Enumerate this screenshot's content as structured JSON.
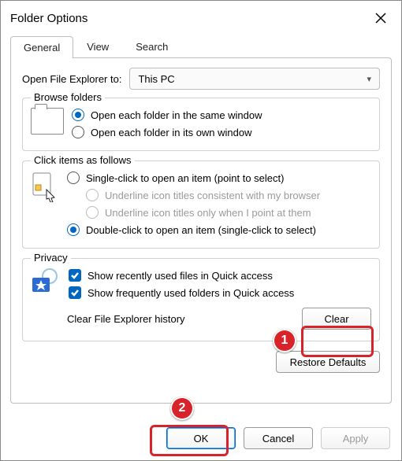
{
  "title": "Folder Options",
  "tabs": {
    "general": "General",
    "view": "View",
    "search": "Search"
  },
  "open_in": {
    "label": "Open File Explorer to:",
    "value": "This PC"
  },
  "browse": {
    "legend": "Browse folders",
    "opt1": "Open each folder in the same window",
    "opt2": "Open each folder in its own window"
  },
  "click": {
    "legend": "Click items as follows",
    "single": "Single-click to open an item (point to select)",
    "underline_browser": "Underline icon titles consistent with my browser",
    "underline_point": "Underline icon titles only when I point at them",
    "double": "Double-click to open an item (single-click to select)"
  },
  "privacy": {
    "legend": "Privacy",
    "recent_files": "Show recently used files in Quick access",
    "freq_folders": "Show frequently used folders in Quick access",
    "clear_label": "Clear File Explorer history",
    "clear_btn": "Clear"
  },
  "restore_btn": "Restore Defaults",
  "buttons": {
    "ok": "OK",
    "cancel": "Cancel",
    "apply": "Apply"
  },
  "markers": {
    "one": "1",
    "two": "2"
  }
}
